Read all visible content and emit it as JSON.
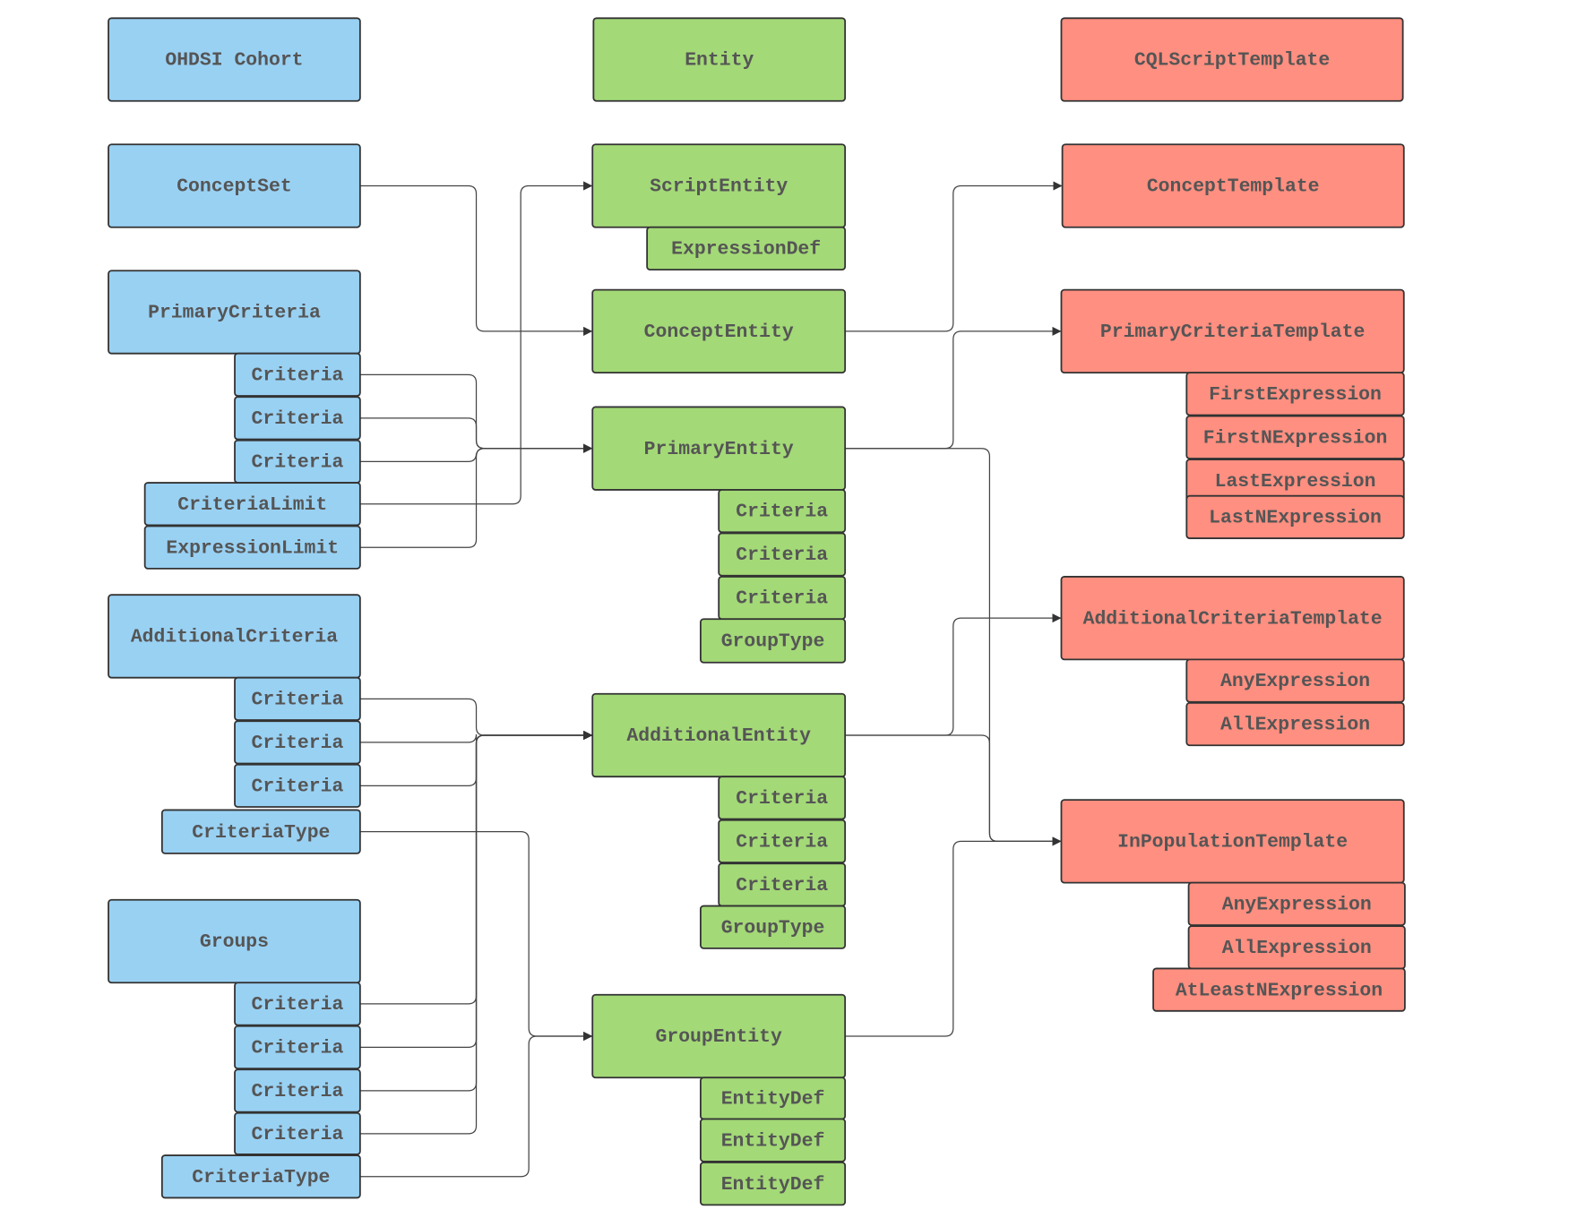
{
  "colors": {
    "cohort": "#99d1f3",
    "entity": "#a3d977",
    "template": "#ff8f80",
    "border": "#333333",
    "text": "#555555"
  },
  "nodes": [
    {
      "id": "ohdsi",
      "label": "OHDSI Cohort",
      "group": "cohort"
    },
    {
      "id": "conceptset",
      "label": "ConceptSet",
      "group": "cohort"
    },
    {
      "id": "primarycriteria",
      "label": "PrimaryCriteria",
      "group": "cohort"
    },
    {
      "id": "pc_c1",
      "label": "Criteria",
      "group": "cohort"
    },
    {
      "id": "pc_c2",
      "label": "Criteria",
      "group": "cohort"
    },
    {
      "id": "pc_c3",
      "label": "Criteria",
      "group": "cohort"
    },
    {
      "id": "criterialimit",
      "label": "CriteriaLimit",
      "group": "cohort"
    },
    {
      "id": "expressionlimit",
      "label": "ExpressionLimit",
      "group": "cohort"
    },
    {
      "id": "additionalcriteria",
      "label": "AdditionalCriteria",
      "group": "cohort"
    },
    {
      "id": "ac_c1",
      "label": "Criteria",
      "group": "cohort"
    },
    {
      "id": "ac_c2",
      "label": "Criteria",
      "group": "cohort"
    },
    {
      "id": "ac_c3",
      "label": "Criteria",
      "group": "cohort"
    },
    {
      "id": "ac_type",
      "label": "CriteriaType",
      "group": "cohort"
    },
    {
      "id": "groups",
      "label": "Groups",
      "group": "cohort"
    },
    {
      "id": "g_c1",
      "label": "Criteria",
      "group": "cohort"
    },
    {
      "id": "g_c2",
      "label": "Criteria",
      "group": "cohort"
    },
    {
      "id": "g_c3",
      "label": "Criteria",
      "group": "cohort"
    },
    {
      "id": "g_c4",
      "label": "Criteria",
      "group": "cohort"
    },
    {
      "id": "g_type",
      "label": "CriteriaType",
      "group": "cohort"
    },
    {
      "id": "entity",
      "label": "Entity",
      "group": "entity"
    },
    {
      "id": "scriptentity",
      "label": "ScriptEntity",
      "group": "entity"
    },
    {
      "id": "expressiondef",
      "label": "ExpressionDef",
      "group": "entity"
    },
    {
      "id": "conceptentity",
      "label": "ConceptEntity",
      "group": "entity"
    },
    {
      "id": "primaryentity",
      "label": "PrimaryEntity",
      "group": "entity"
    },
    {
      "id": "pe_c1",
      "label": "Criteria",
      "group": "entity"
    },
    {
      "id": "pe_c2",
      "label": "Criteria",
      "group": "entity"
    },
    {
      "id": "pe_c3",
      "label": "Criteria",
      "group": "entity"
    },
    {
      "id": "pe_gt",
      "label": "GroupType",
      "group": "entity"
    },
    {
      "id": "additionalentity",
      "label": "AdditionalEntity",
      "group": "entity"
    },
    {
      "id": "ae_c1",
      "label": "Criteria",
      "group": "entity"
    },
    {
      "id": "ae_c2",
      "label": "Criteria",
      "group": "entity"
    },
    {
      "id": "ae_c3",
      "label": "Criteria",
      "group": "entity"
    },
    {
      "id": "ae_gt",
      "label": "GroupType",
      "group": "entity"
    },
    {
      "id": "groupentity",
      "label": "GroupEntity",
      "group": "entity"
    },
    {
      "id": "ge_d1",
      "label": "EntityDef",
      "group": "entity"
    },
    {
      "id": "ge_d2",
      "label": "EntityDef",
      "group": "entity"
    },
    {
      "id": "ge_d3",
      "label": "EntityDef",
      "group": "entity"
    },
    {
      "id": "cqlscripttemplate",
      "label": "CQLScriptTemplate",
      "group": "template"
    },
    {
      "id": "concepttemplate",
      "label": "ConceptTemplate",
      "group": "template"
    },
    {
      "id": "primarycriteriatemplate",
      "label": "PrimaryCriteriaTemplate",
      "group": "template"
    },
    {
      "id": "firstexpression",
      "label": "FirstExpression",
      "group": "template"
    },
    {
      "id": "firstnexpression",
      "label": "FirstNExpression",
      "group": "template"
    },
    {
      "id": "lastexpression",
      "label": "LastExpression",
      "group": "template"
    },
    {
      "id": "lastnexpression",
      "label": "LastNExpression",
      "group": "template"
    },
    {
      "id": "additionalcriteriatemplate",
      "label": "AdditionalCriteriaTemplate",
      "group": "template"
    },
    {
      "id": "act_any",
      "label": "AnyExpression",
      "group": "template"
    },
    {
      "id": "act_all",
      "label": "AllExpression",
      "group": "template"
    },
    {
      "id": "inpopulationtemplate",
      "label": "InPopulationTemplate",
      "group": "template"
    },
    {
      "id": "ipt_any",
      "label": "AnyExpression",
      "group": "template"
    },
    {
      "id": "ipt_all",
      "label": "AllExpression",
      "group": "template"
    },
    {
      "id": "ipt_atleastn",
      "label": "AtLeastNExpression",
      "group": "template"
    }
  ],
  "edges": [
    {
      "from": "conceptset",
      "to": "conceptentity"
    },
    {
      "from": "pc_c1",
      "to": "primaryentity"
    },
    {
      "from": "pc_c2",
      "to": "primaryentity"
    },
    {
      "from": "pc_c3",
      "to": "primaryentity"
    },
    {
      "from": "criterialimit",
      "to": "scriptentity"
    },
    {
      "from": "expressionlimit",
      "to": "primaryentity"
    },
    {
      "from": "ac_c1",
      "to": "additionalentity"
    },
    {
      "from": "ac_c2",
      "to": "additionalentity"
    },
    {
      "from": "ac_c3",
      "to": "additionalentity"
    },
    {
      "from": "g_c1",
      "to": "additionalentity"
    },
    {
      "from": "g_c2",
      "to": "additionalentity"
    },
    {
      "from": "g_c3",
      "to": "additionalentity"
    },
    {
      "from": "g_c4",
      "to": "additionalentity"
    },
    {
      "from": "ac_type",
      "to": "groupentity"
    },
    {
      "from": "g_type",
      "to": "groupentity"
    },
    {
      "from": "conceptentity",
      "to": "concepttemplate"
    },
    {
      "from": "primaryentity",
      "to": "primarycriteriatemplate"
    },
    {
      "from": "primaryentity",
      "to": "inpopulationtemplate"
    },
    {
      "from": "additionalentity",
      "to": "additionalcriteriatemplate"
    },
    {
      "from": "additionalentity",
      "to": "inpopulationtemplate"
    },
    {
      "from": "groupentity",
      "to": "inpopulationtemplate"
    }
  ]
}
